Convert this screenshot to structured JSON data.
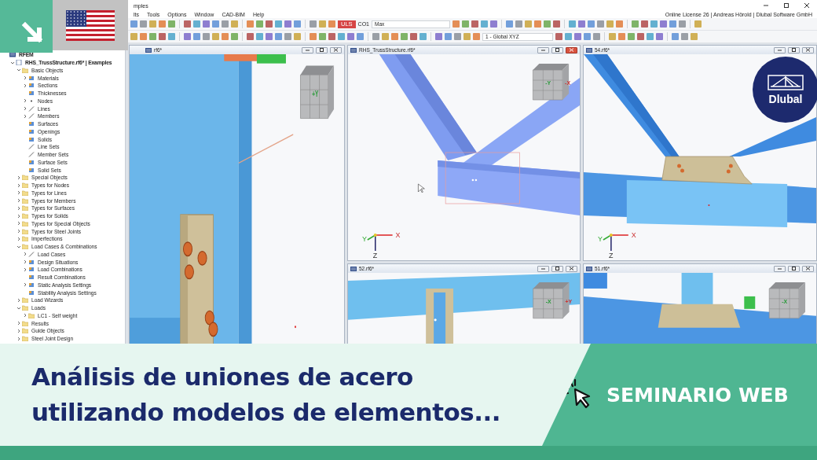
{
  "window": {
    "title": "mples",
    "menu": [
      "lts",
      "Tools",
      "Options",
      "Window",
      "CAD-BIM",
      "Help"
    ],
    "license": "Online License 26 | Andreas Hörold | Dlubal Software GmbH"
  },
  "toolbar": {
    "load_type": "ULS",
    "combination": "CO1",
    "result": "Max",
    "coordinate_system": "1 - Global XYZ"
  },
  "tree": [
    {
      "label": "RFEM",
      "kind": "app",
      "children": [
        {
          "label": "RHS_TrussStructure.rf6* | Examples",
          "kind": "file",
          "expanded": true,
          "children": [
            {
              "label": "Basic Objects",
              "kind": "folder",
              "expanded": true,
              "children": [
                {
                  "label": "Materials",
                  "kind": "object",
                  "expanded": false
                },
                {
                  "label": "Sections",
                  "kind": "object",
                  "expanded": false
                },
                {
                  "label": "Thicknesses",
                  "kind": "object"
                },
                {
                  "label": "Nodes",
                  "kind": "dot",
                  "expanded": false
                },
                {
                  "label": "Lines",
                  "kind": "line",
                  "expanded": false
                },
                {
                  "label": "Members",
                  "kind": "line",
                  "expanded": false
                },
                {
                  "label": "Surfaces",
                  "kind": "object"
                },
                {
                  "label": "Openings",
                  "kind": "object"
                },
                {
                  "label": "Solids",
                  "kind": "object"
                },
                {
                  "label": "Line Sets",
                  "kind": "line"
                },
                {
                  "label": "Member Sets",
                  "kind": "line"
                },
                {
                  "label": "Surface Sets",
                  "kind": "object"
                },
                {
                  "label": "Solid Sets",
                  "kind": "object"
                }
              ]
            },
            {
              "label": "Special Objects",
              "kind": "folder",
              "expanded": false
            },
            {
              "label": "Types for Nodes",
              "kind": "folder",
              "expanded": false
            },
            {
              "label": "Types for Lines",
              "kind": "folder",
              "expanded": false
            },
            {
              "label": "Types for Members",
              "kind": "folder",
              "expanded": false
            },
            {
              "label": "Types for Surfaces",
              "kind": "folder",
              "expanded": false
            },
            {
              "label": "Types for Solids",
              "kind": "folder",
              "expanded": false
            },
            {
              "label": "Types for Special Objects",
              "kind": "folder",
              "expanded": false
            },
            {
              "label": "Types for Steel Joints",
              "kind": "folder",
              "expanded": false
            },
            {
              "label": "Imperfections",
              "kind": "folder",
              "expanded": false
            },
            {
              "label": "Load Cases & Combinations",
              "kind": "folder",
              "expanded": true,
              "children": [
                {
                  "label": "Load Cases",
                  "kind": "line",
                  "expanded": false
                },
                {
                  "label": "Design Situations",
                  "kind": "object",
                  "expanded": false
                },
                {
                  "label": "Load Combinations",
                  "kind": "object",
                  "expanded": false
                },
                {
                  "label": "Result Combinations",
                  "kind": "object"
                },
                {
                  "label": "Static Analysis Settings",
                  "kind": "object",
                  "expanded": false
                },
                {
                  "label": "Stability Analysis Settings",
                  "kind": "object"
                }
              ]
            },
            {
              "label": "Load Wizards",
              "kind": "folder",
              "expanded": false
            },
            {
              "label": "Loads",
              "kind": "folder",
              "expanded": true,
              "children": [
                {
                  "label": "LC1 - Self weight",
                  "kind": "folder",
                  "expanded": false
                }
              ]
            },
            {
              "label": "Results",
              "kind": "folder",
              "expanded": false
            },
            {
              "label": "Guide Objects",
              "kind": "folder",
              "expanded": false
            },
            {
              "label": "Steel Joint Design",
              "kind": "folder",
              "expanded": false
            }
          ]
        }
      ]
    }
  ],
  "viewports": [
    {
      "title": "rf6*",
      "active": false,
      "kind": "column-plate",
      "cube_labels": [
        "+Y"
      ]
    },
    {
      "title": "RHS_TrussStructure.rf6*",
      "active": true,
      "kind": "rhs-truss",
      "cube_labels": [
        "-Y",
        "-X"
      ],
      "axes": [
        "X",
        "Y",
        "Z"
      ]
    },
    {
      "title": "54.rf6*",
      "active": false,
      "kind": "gusset-truss",
      "axes": [
        "X",
        "Y",
        "Z"
      ]
    },
    {
      "title": "52.rf6*",
      "active": false,
      "kind": "beam-stiffener",
      "cube_labels": [
        "-X",
        "+Y"
      ]
    },
    {
      "title": "51.rf6*",
      "active": false,
      "kind": "column-base",
      "cube_labels": [
        "-X"
      ]
    }
  ],
  "logo": {
    "text": "Dlubal"
  },
  "banner": {
    "title": "Análisis de uniones de acero utilizando modelos de elementos...",
    "tag": "SEMINARIO WEB"
  }
}
